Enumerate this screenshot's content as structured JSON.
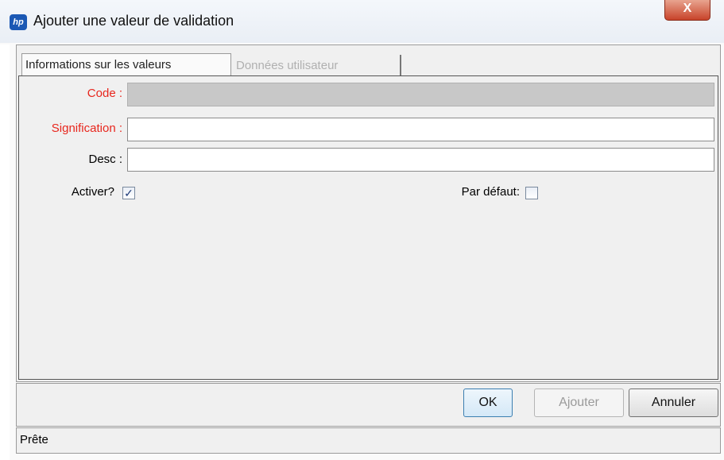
{
  "window": {
    "title": "Ajouter une valeur de validation",
    "app_icon": "hp",
    "close_glyph": "X"
  },
  "tabs": [
    {
      "label": "Informations sur les valeurs",
      "active": true
    },
    {
      "label": "Données utilisateur",
      "active": false
    }
  ],
  "form": {
    "code_label": "Code :",
    "code_value": "",
    "signification_label": "Signification :",
    "signification_value": "",
    "desc_label": "Desc :",
    "desc_value": "",
    "activer_label": "Activer?",
    "activer_checked": true,
    "par_defaut_label": "Par défaut:",
    "par_defaut_checked": false
  },
  "buttons": {
    "ok": "OK",
    "ajouter": "Ajouter",
    "annuler": "Annuler"
  },
  "status": {
    "text": "Prête"
  },
  "colors": {
    "required_label": "#e8261d",
    "close_button": "#c8432a",
    "app_icon": "#1b58b4"
  }
}
